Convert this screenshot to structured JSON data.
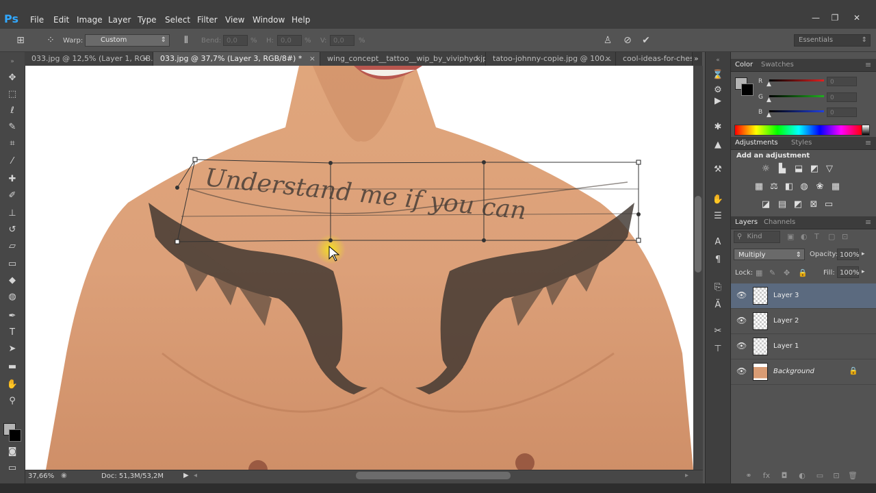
{
  "app": {
    "logo": "Ps"
  },
  "menu": [
    "File",
    "Edit",
    "Image",
    "Layer",
    "Type",
    "Select",
    "Filter",
    "View",
    "Window",
    "Help"
  ],
  "window_controls": {
    "minimize": "—",
    "maximize": "❐",
    "close": "✕"
  },
  "options": {
    "warp_label": "Warp:",
    "warp_value": "Custom",
    "bend_label": "Bend:",
    "bend_value": "0,0",
    "bend_unit": "%",
    "h_label": "H:",
    "h_value": "0,0",
    "h_unit": "%",
    "v_label": "V:",
    "v_value": "0,0",
    "v_unit": "%",
    "workspace": "Essentials"
  },
  "tabs": [
    {
      "label": "033.jpg @ 12,5% (Layer 1, RGB...",
      "active": false
    },
    {
      "label": "033.jpg @ 37,7% (Layer 3, RGB/8#) *",
      "active": true
    },
    {
      "label": "wing_concept__tattoo__wip_by_viviphyd.jpg",
      "active": false
    },
    {
      "label": "tatoo-johnny-copie.jpg @ 100...",
      "active": false
    },
    {
      "label": "cool-ideas-for-chest-tatt",
      "active": false
    }
  ],
  "tab_close": "×",
  "tab_overflow": "»",
  "canvas": {
    "tattoo_text": "Understand me if you can",
    "highlight_color": "#f5e21c"
  },
  "status": {
    "zoom": "37,66%",
    "doc": "Doc: 51,3M/53,2M"
  },
  "color_panel": {
    "tabs": [
      "Color",
      "Swatches"
    ],
    "channels": [
      {
        "label": "R",
        "value": "0",
        "color": "#e02020"
      },
      {
        "label": "G",
        "value": "0",
        "color": "#20b020"
      },
      {
        "label": "B",
        "value": "0",
        "color": "#2040e0"
      }
    ],
    "foreground": "#b4b4b4",
    "background": "#000000"
  },
  "adjustments_panel": {
    "tabs": [
      "Adjustments",
      "Styles"
    ],
    "title": "Add an adjustment"
  },
  "layers_panel": {
    "tabs": [
      "Layers",
      "Channels"
    ],
    "kind_label": "Kind",
    "blend_mode": "Multiply",
    "opacity_label": "Opacity:",
    "opacity_value": "100%",
    "lock_label": "Lock:",
    "fill_label": "Fill:",
    "fill_value": "100%",
    "layers": [
      {
        "name": "Layer 3",
        "selected": true
      },
      {
        "name": "Layer 2",
        "selected": false
      },
      {
        "name": "Layer 1",
        "selected": false
      },
      {
        "name": "Background",
        "selected": false,
        "locked": true
      }
    ]
  }
}
